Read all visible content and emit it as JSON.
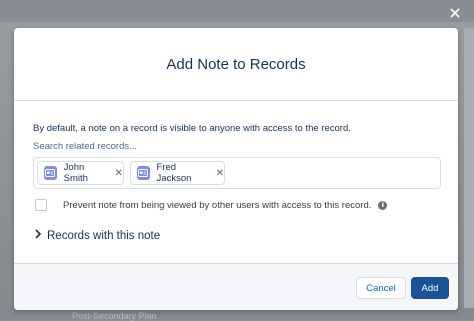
{
  "background": {
    "footer_text": "Post-Secondary Plan"
  },
  "modal": {
    "title": "Add Note to Records",
    "info_text": "By default, a note on a record is visible to anyone with access to the record.",
    "search_placeholder": "Search related records...",
    "selected_records": [
      {
        "label": "John Smith",
        "icon": "contact-card-icon"
      },
      {
        "label": "Fred Jackson",
        "icon": "contact-card-icon"
      }
    ],
    "remove_glyph": "✕",
    "privacy_checkbox": {
      "label": "Prevent note from being viewed by other users with access to this record.",
      "checked": false
    },
    "records_section": {
      "label": "Records with this note",
      "expanded": false
    },
    "footer": {
      "cancel_label": "Cancel",
      "add_label": "Add"
    }
  },
  "colors": {
    "brand_button": "#1b5297",
    "link_blue": "#0070d2",
    "pill_icon": "#7f8de1",
    "title_text": "#16325c"
  }
}
